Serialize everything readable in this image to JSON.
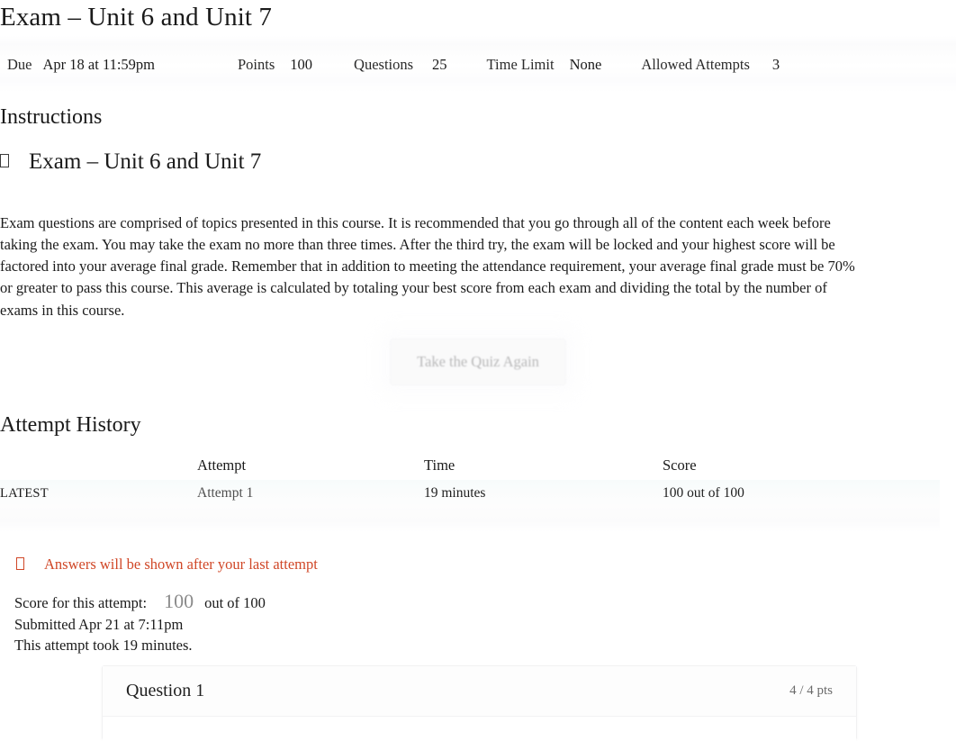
{
  "quiz": {
    "title": "Exam – Unit 6 and Unit 7",
    "meta": {
      "due_label": "Due",
      "due_value": "Apr 18 at 11:59pm",
      "points_label": "Points",
      "points_value": "100",
      "questions_label": "Questions",
      "questions_value": "25",
      "time_limit_label": "Time Limit",
      "time_limit_value": "None",
      "allowed_attempts_label": "Allowed Attempts",
      "allowed_attempts_value": "3"
    }
  },
  "instructions": {
    "heading": "Instructions",
    "subtitle": "Exam – Unit 6 and Unit 7",
    "subtitle_icon": "missing-glyph-box",
    "body": "Exam questions are comprised of topics presented in this course. It is recommended that you go through all of the content each week before taking the exam. You may take the exam no more than three times. After the third try, the exam will be locked and your highest score will be factored into your average final grade. Remember that in addition to meeting the attendance requirement, your average final grade must be 70% or greater to pass this course. This average is calculated by totaling your best score from each exam and dividing the total by the number of exams in this course."
  },
  "retake": {
    "label": "Take the Quiz Again"
  },
  "attempt_history": {
    "heading": "Attempt History",
    "columns": [
      "",
      "Attempt",
      "Time",
      "Score"
    ],
    "rows": [
      {
        "badge": "LATEST",
        "attempt": "Attempt 1",
        "time": "19 minutes",
        "score": "100 out of 100"
      }
    ]
  },
  "notice": {
    "icon": "missing-glyph-box",
    "text": "Answers will be shown after your last attempt",
    "color": "#d04727"
  },
  "score_summary": {
    "label": "Score for this attempt:",
    "value": "100",
    "out_of": "out of 100",
    "submitted": "Submitted Apr 21 at 7:11pm",
    "duration": "This attempt took 19 minutes."
  },
  "questions": [
    {
      "name": "Question 1",
      "points": "4 / 4 pts"
    }
  ]
}
